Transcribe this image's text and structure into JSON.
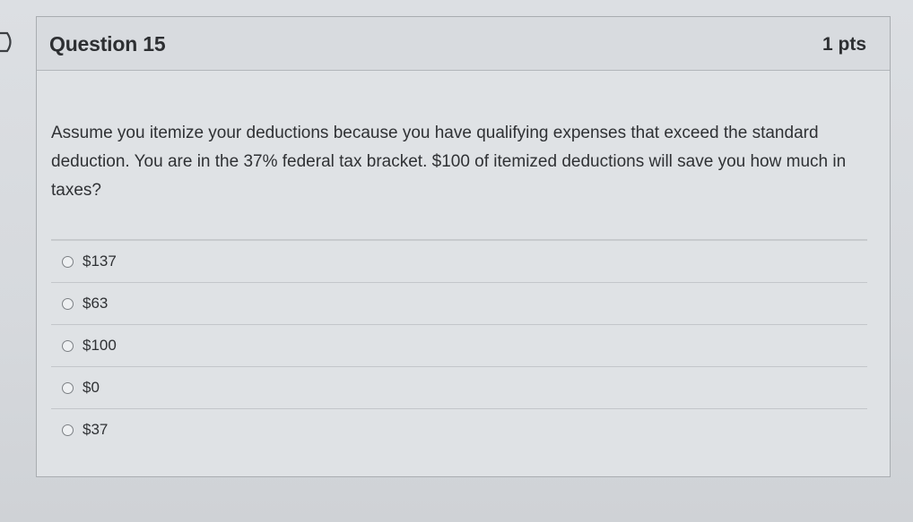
{
  "question": {
    "title": "Question 15",
    "points": "1 pts",
    "text": "Assume you itemize your deductions because you have qualifying expenses that exceed the standard deduction. You are in the 37% federal tax bracket. $100 of itemized deductions will save you how much in taxes?"
  },
  "answers": [
    {
      "label": "$137"
    },
    {
      "label": "$63"
    },
    {
      "label": "$100"
    },
    {
      "label": "$0"
    },
    {
      "label": "$37"
    }
  ],
  "colors": {
    "card_background": "#dfe2e5",
    "header_background": "#d8dbdf",
    "text": "#2f3134",
    "border": "#a9adb1"
  },
  "icons": {
    "nav": "chevron-right-icon",
    "radio": "radio-unselected-icon"
  }
}
